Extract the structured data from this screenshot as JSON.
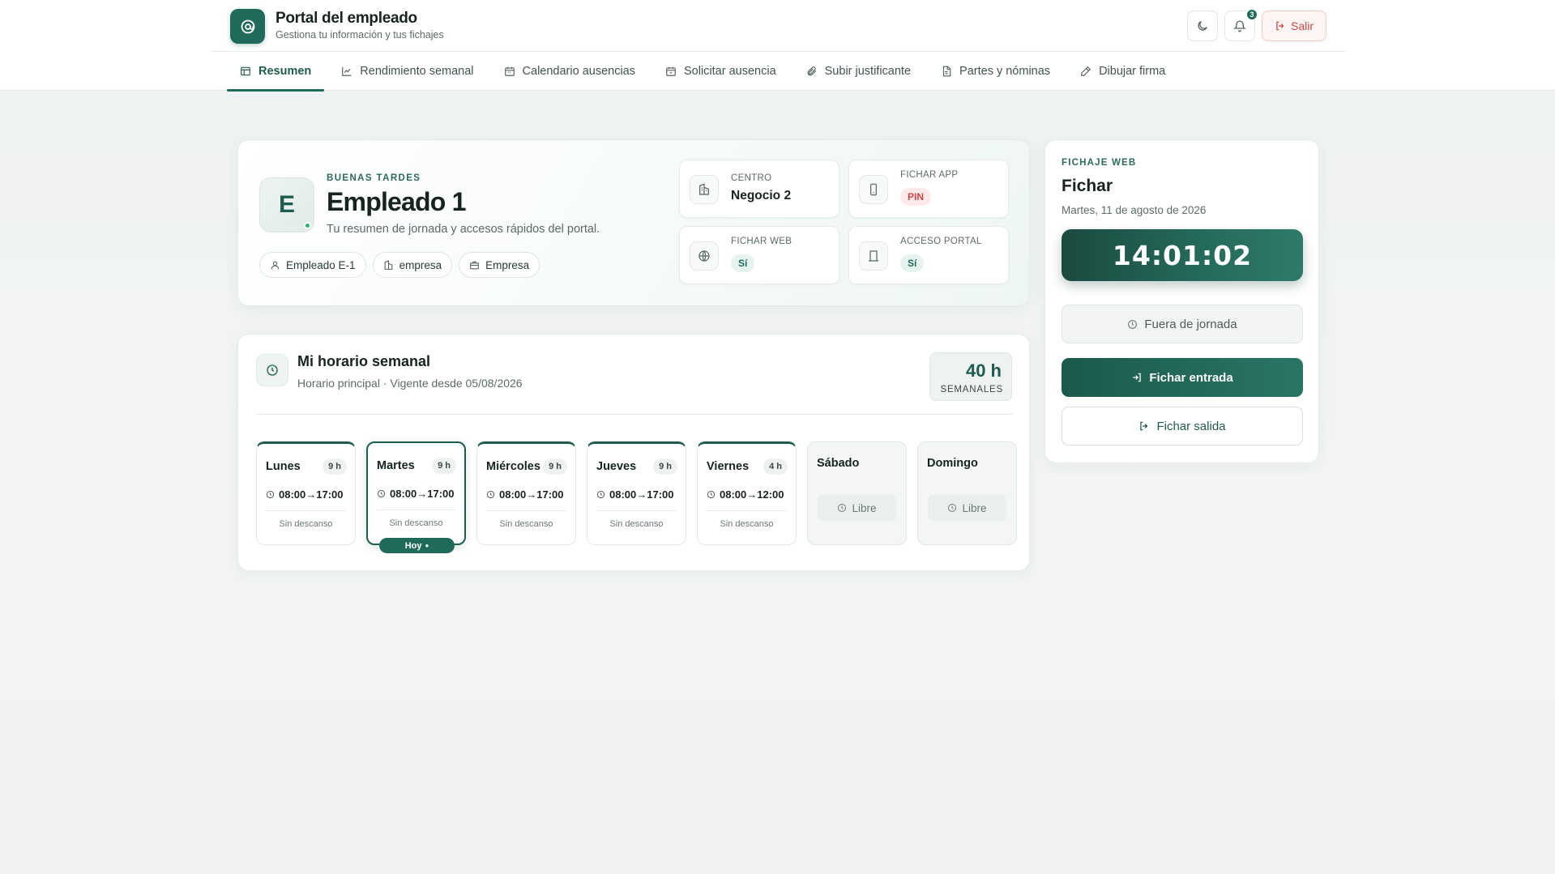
{
  "header": {
    "title": "Portal del empleado",
    "subtitle": "Gestiona tu información y tus fichajes",
    "notification_count": "3",
    "logout_label": "Salir"
  },
  "tabs": [
    {
      "label": "Resumen",
      "icon": "layout-icon",
      "active": true
    },
    {
      "label": "Rendimiento semanal",
      "icon": "chart-icon"
    },
    {
      "label": "Calendario ausencias",
      "icon": "calendar-icon"
    },
    {
      "label": "Solicitar ausencia",
      "icon": "calendar-plus-icon"
    },
    {
      "label": "Subir justificante",
      "icon": "paperclip-icon"
    },
    {
      "label": "Partes y nóminas",
      "icon": "document-icon"
    },
    {
      "label": "Dibujar firma",
      "icon": "pen-icon"
    }
  ],
  "welcome": {
    "initial": "E",
    "eyebrow": "BUENAS TARDES",
    "name": "Empleado 1",
    "subtitle": "Tu resumen de jornada y accesos rápidos del portal.",
    "chips": [
      "Empleado E-1",
      "empresa",
      "Empresa"
    ],
    "tiles": {
      "centro": {
        "label": "CENTRO",
        "value": "Negocio 2"
      },
      "fichar_app": {
        "label": "FICHAR APP",
        "value": "PIN"
      },
      "fichar_web": {
        "label": "FICHAR WEB",
        "value": "Sí"
      },
      "acceso_portal": {
        "label": "ACCESO PORTAL",
        "value": "Sí"
      }
    }
  },
  "schedule": {
    "title": "Mi horario semanal",
    "subtitle": "Horario principal · Vigente desde 05/08/2026",
    "total_hours": "40 h",
    "total_label": "SEMANALES",
    "days": [
      {
        "name": "Lunes",
        "hours": "9 h",
        "start": "08:00",
        "end": "17:00",
        "rest": "Sin descanso",
        "off": false
      },
      {
        "name": "Martes",
        "hours": "9 h",
        "start": "08:00",
        "end": "17:00",
        "rest": "Sin descanso",
        "off": false,
        "today": true
      },
      {
        "name": "Miércoles",
        "hours": "9 h",
        "start": "08:00",
        "end": "17:00",
        "rest": "Sin descanso",
        "off": false
      },
      {
        "name": "Jueves",
        "hours": "9 h",
        "start": "08:00",
        "end": "17:00",
        "rest": "Sin descanso",
        "off": false
      },
      {
        "name": "Viernes",
        "hours": "4 h",
        "start": "08:00",
        "end": "12:00",
        "rest": "Sin descanso",
        "off": false
      },
      {
        "name": "Sábado",
        "off": true,
        "libre": "Libre"
      },
      {
        "name": "Domingo",
        "off": true,
        "libre": "Libre"
      }
    ],
    "today_badge": "Hoy"
  },
  "fichaje": {
    "eyebrow": "FICHAJE WEB",
    "title": "Fichar",
    "date": "Martes, 11 de agosto de 2026",
    "clock": "14:01:02",
    "status": "Fuera de jornada",
    "entrada": "Fichar entrada",
    "salida": "Fichar salida"
  },
  "colors": {
    "primary": "#1f6a5a",
    "danger": "#c84848",
    "online": "#27b56a"
  }
}
